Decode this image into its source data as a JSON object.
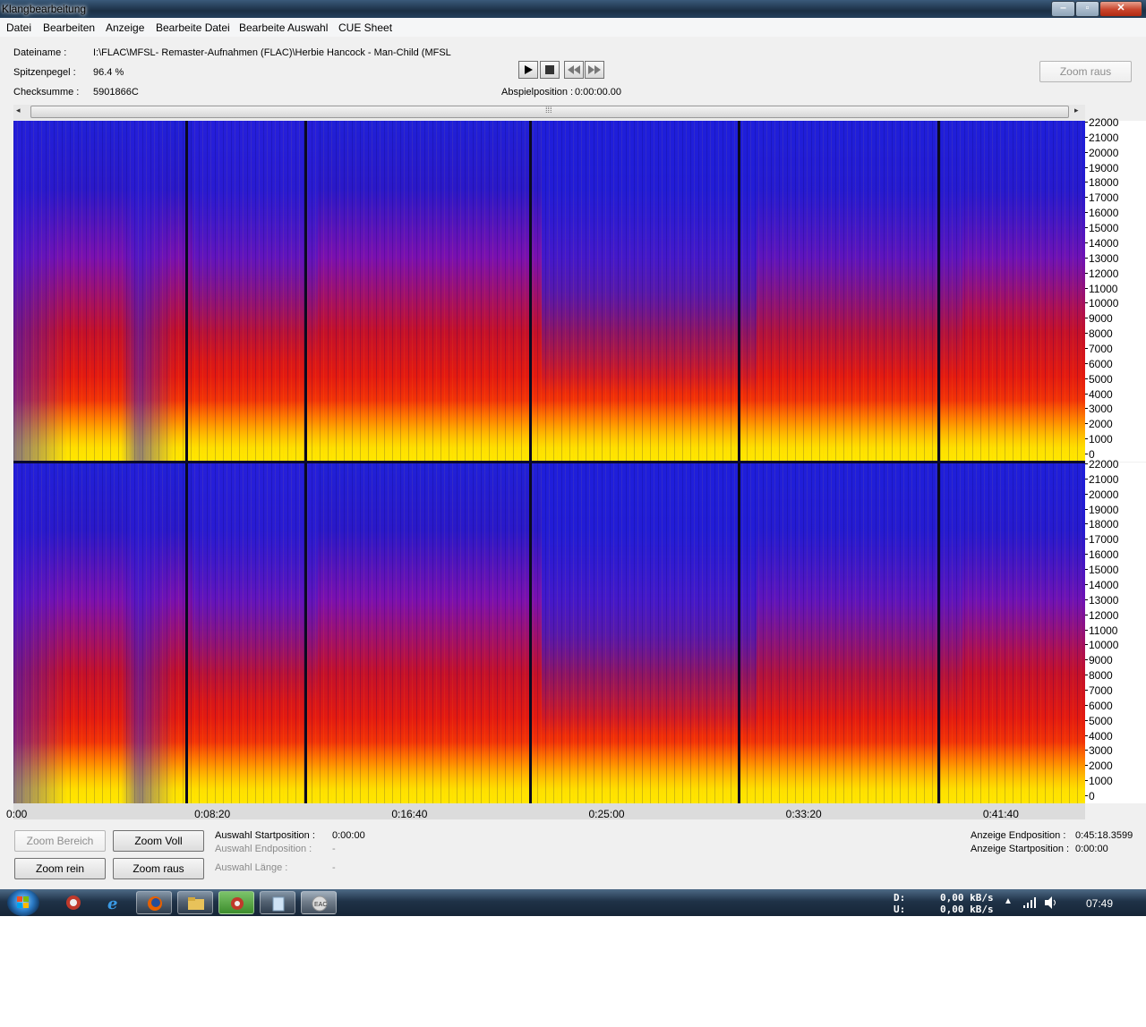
{
  "window": {
    "title": "Klangbearbeitung"
  },
  "menu": [
    "Datei",
    "Bearbeiten",
    "Anzeige",
    "Bearbeite Datei",
    "Bearbeite Auswahl",
    "CUE Sheet"
  ],
  "info": {
    "filename_label": "Dateiname :",
    "filename_value": "I:\\FLAC\\MFSL- Remaster-Aufnahmen (FLAC)\\Herbie Hancock - Man-Child (MFSL",
    "peak_label": "Spitzenpegel :",
    "peak_value": "96.4 %",
    "checksum_label": "Checksumme :",
    "checksum_value": "5901866C",
    "playpos_label": "Abspielposition :",
    "playpos_value": "0:00:00.00"
  },
  "buttons": {
    "zoom_out_top": "Zoom raus",
    "zoom_range": "Zoom Bereich",
    "zoom_full": "Zoom Voll",
    "zoom_in": "Zoom rein",
    "zoom_out": "Zoom raus"
  },
  "selection": {
    "start_label": "Auswahl Startposition :",
    "start_value": "0:00:00",
    "end_label": "Auswahl Endposition :",
    "end_value": "-",
    "length_label": "Auswahl Länge :",
    "length_value": "-"
  },
  "view": {
    "end_label": "Anzeige Endposition :",
    "end_value": "0:45:18.3599",
    "start_label": "Anzeige Startposition :",
    "start_value": "0:00:00"
  },
  "freq_ticks": [
    "22000",
    "21000",
    "20000",
    "19000",
    "18000",
    "17000",
    "16000",
    "15000",
    "14000",
    "13000",
    "12000",
    "11000",
    "10000",
    "9000",
    "8000",
    "7000",
    "6000",
    "5000",
    "4000",
    "3000",
    "2000",
    "1000",
    "0"
  ],
  "time_ticks": [
    "0:00",
    "0:08:20",
    "0:16:40",
    "0:25:00",
    "0:33:20",
    "0:41:40"
  ],
  "track_boundaries_seconds": [
    438,
    740,
    1310,
    1840,
    2345
  ],
  "total_seconds": 2718.36,
  "taskbar": {
    "net_d_label": "D:",
    "net_d_value": "0,00 kB/s",
    "net_u_label": "U:",
    "net_u_value": "0,00 kB/s",
    "clock": "07:49"
  },
  "colors": {
    "low": "#2020d8",
    "mid": "#e41a10",
    "high": "#ffe600"
  }
}
